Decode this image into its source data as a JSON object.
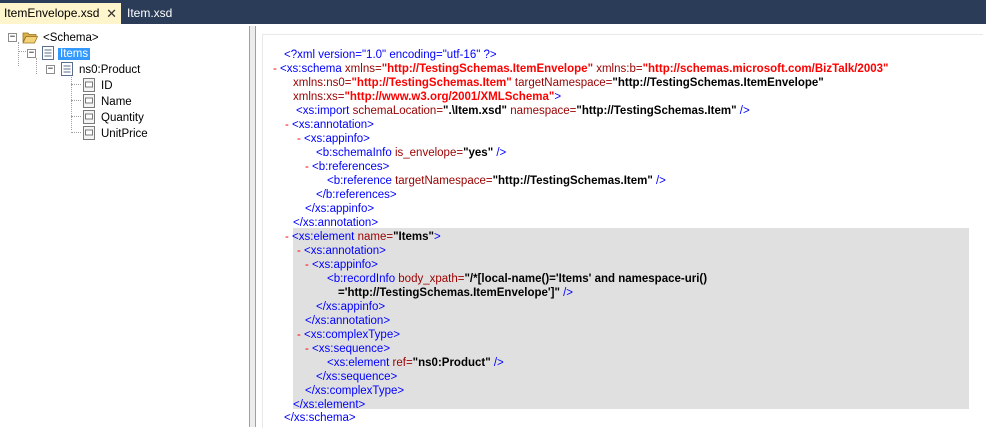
{
  "tabs": [
    {
      "label": "ItemEnvelope.xsd",
      "active": true
    },
    {
      "label": "Item.xsd",
      "active": false
    }
  ],
  "tree": {
    "root": "<Schema>",
    "items": "Items",
    "product": "ns0:Product",
    "fields": [
      "ID",
      "Name",
      "Quantity",
      "UnitPrice"
    ]
  },
  "xml": {
    "l1": {
      "open": "<?xml version=\"1.0\" encoding=\"utf-16\" ?>"
    },
    "l2": {
      "m": "-",
      "tag": "<xs:schema",
      "a1": " xmlns=",
      "v1": "\"http://TestingSchemas.ItemEnvelope\"",
      "a2": " xmlns:b=",
      "v2": "\"http://schemas.microsoft.com/BizTalk/2003\""
    },
    "l3": {
      "a1": "xmlns:ns0=",
      "v1": "\"http://TestingSchemas.Item\"",
      "a2": " targetNamespace=",
      "v2": "\"http://TestingSchemas.ItemEnvelope\""
    },
    "l4": {
      "a1": "xmlns:xs=",
      "v1": "\"http://www.w3.org/2001/XMLSchema\"",
      "close": ">"
    },
    "l5": {
      "tag": "<xs:import",
      "a1": " schemaLocation=",
      "v1": "\".\\Item.xsd\"",
      "a2": " namespace=",
      "v2": "\"http://TestingSchemas.Item\"",
      "close": " />"
    },
    "l6": {
      "m": "-",
      "tag": "<xs:annotation>"
    },
    "l7": {
      "m": "-",
      "tag": "<xs:appinfo>"
    },
    "l8": {
      "tag": "<b:schemaInfo",
      "a1": " is_envelope=",
      "v1": "\"yes\"",
      "close": " />"
    },
    "l9": {
      "m": "-",
      "tag": "<b:references>"
    },
    "l10": {
      "tag": "<b:reference",
      "a1": " targetNamespace=",
      "v1": "\"http://TestingSchemas.Item\"",
      "close": " />"
    },
    "l11": {
      "tag": "</b:references>"
    },
    "l12": {
      "tag": "</xs:appinfo>"
    },
    "l13": {
      "tag": "</xs:annotation>"
    },
    "l14": {
      "m": "-",
      "tag": "<xs:element",
      "a1": " name=",
      "v1": "\"Items\"",
      "close": ">"
    },
    "l15": {
      "m": "-",
      "tag": "<xs:annotation>"
    },
    "l16": {
      "m": "-",
      "tag": "<xs:appinfo>"
    },
    "l17": {
      "tag": "<b:recordInfo",
      "a1": " body_xpath=",
      "v1": "\"/*[local-name()='Items' and namespace-uri()"
    },
    "l18": {
      "v1": "='http://TestingSchemas.ItemEnvelope']\"",
      "close": " />"
    },
    "l19": {
      "tag": "</xs:appinfo>"
    },
    "l20": {
      "tag": "</xs:annotation>"
    },
    "l21": {
      "m": "-",
      "tag": "<xs:complexType>"
    },
    "l22": {
      "m": "-",
      "tag": "<xs:sequence>"
    },
    "l23": {
      "tag": "<xs:element",
      "a1": " ref=",
      "v1": "\"ns0:Product\"",
      "close": " />"
    },
    "l24": {
      "tag": "</xs:sequence>"
    },
    "l25": {
      "tag": "</xs:complexType>"
    },
    "l26": {
      "tag": "</xs:element>"
    },
    "l27": {
      "tag": "</xs:schema>"
    }
  }
}
